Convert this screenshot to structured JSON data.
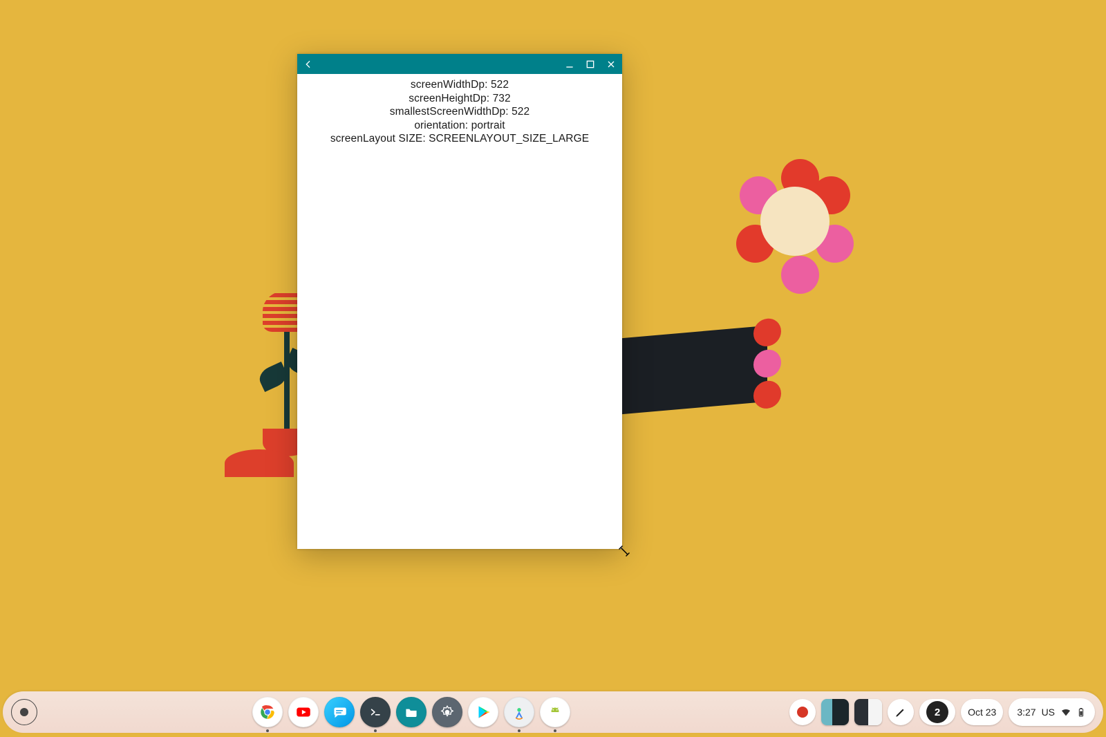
{
  "window": {
    "titlebar_color": "#00808a",
    "lines": {
      "screenWidthDp": "screenWidthDp: 522",
      "screenHeightDp": "screenHeightDp: 732",
      "smallestScreenWidthDp": "smallestScreenWidthDp: 522",
      "orientation": "orientation: portrait",
      "screenLayout": "screenLayout SIZE: SCREENLAYOUT_SIZE_LARGE"
    }
  },
  "shelf": {
    "apps": [
      {
        "name": "chrome"
      },
      {
        "name": "youtube"
      },
      {
        "name": "messages"
      },
      {
        "name": "terminal"
      },
      {
        "name": "files"
      },
      {
        "name": "settings"
      },
      {
        "name": "play-store"
      },
      {
        "name": "android-studio"
      },
      {
        "name": "android-app"
      }
    ]
  },
  "status": {
    "notifications_count": "2",
    "date": "Oct 23",
    "time": "3:27",
    "ime": "US"
  }
}
